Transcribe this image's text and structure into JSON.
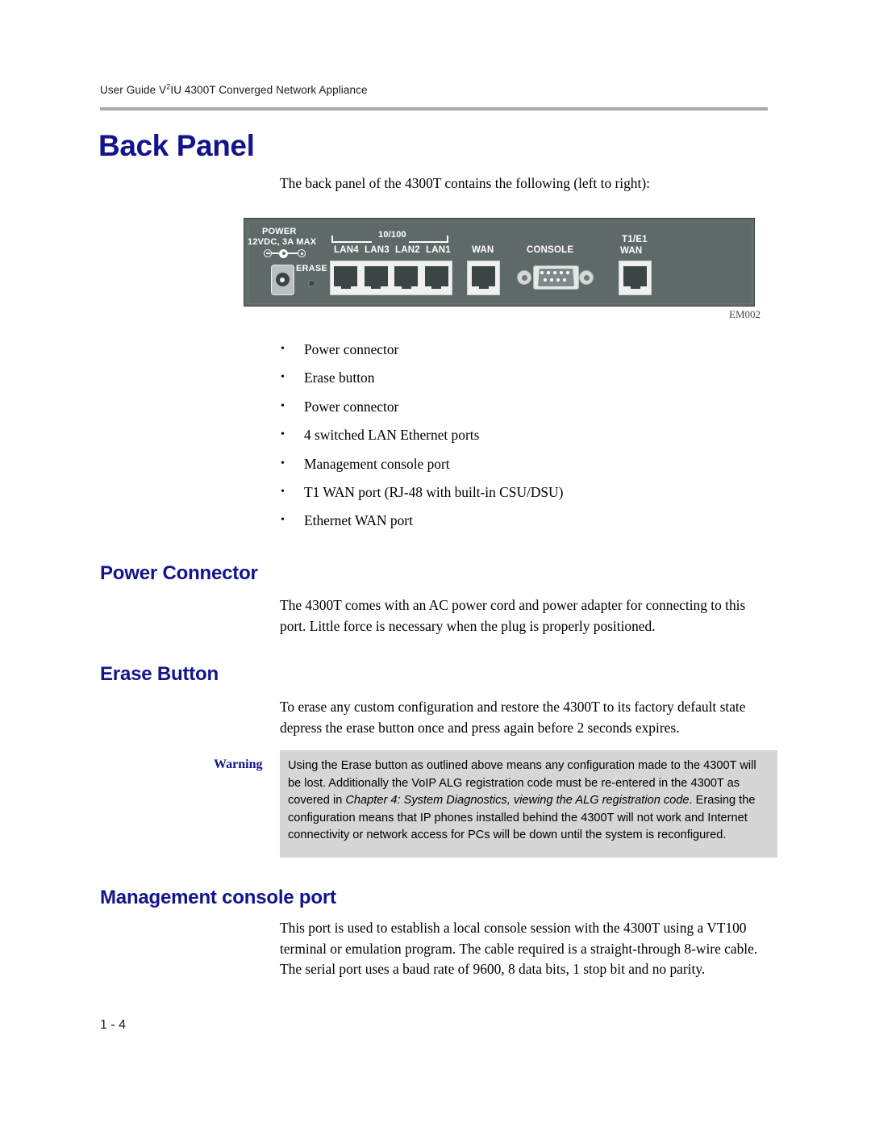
{
  "header": {
    "running_title_pre": "User Guide V",
    "running_title_sup": "2",
    "running_title_post": "IU 4300T Converged Network Appliance"
  },
  "chapter": {
    "title": "Back Panel",
    "intro": "The back panel of the 4300T contains the following (left to right):"
  },
  "figure": {
    "caption": "EM002",
    "panel": {
      "power_label": "POWER",
      "power_spec": "12VDC, 3A MAX",
      "erase_label": "ERASE",
      "speed_label": "10/100",
      "lan4": "LAN4",
      "lan3": "LAN3",
      "lan2": "LAN2",
      "lan1": "LAN1",
      "wan": "WAN",
      "console": "CONSOLE",
      "t1e1": "T1/E1",
      "t1e1_wan": "WAN"
    }
  },
  "bullets": [
    "Power connector",
    "Erase button",
    "Power connector",
    "4 switched LAN Ethernet ports",
    "Management console port",
    "T1 WAN port (RJ-48 with built-in CSU/DSU)",
    "Ethernet WAN port"
  ],
  "sections": {
    "power_connector": {
      "heading": "Power Connector",
      "body": "The 4300T comes with an AC power cord and power adapter for connecting to this port.  Little force is necessary when the plug is properly positioned."
    },
    "erase_button": {
      "heading": "Erase Button",
      "body": "To erase any custom configuration and restore the 4300T to its factory default state depress the erase button once and press again before 2 seconds expires."
    },
    "management_console": {
      "heading": "Management console port",
      "body": "This port is used to establish a local console session with the 4300T using a VT100 terminal or emulation program. The cable required is a straight-through 8-wire cable.  The serial port uses a baud rate of 9600, 8 data bits, 1 stop bit and no parity."
    }
  },
  "warning": {
    "label": "Warning",
    "text_part1": "Using the Erase button as outlined above means any configuration made to the 4300T will be lost.  Additionally the VoIP ALG registration code must be re-entered in the 4300T as covered in ",
    "text_italic": "Chapter 4:  System Diagnostics, viewing the ALG registration code",
    "text_part2": ".  Erasing the configuration means that IP phones installed behind the 4300T will not work and Internet connectivity or network access for PCs will be down until the system is reconfigured."
  },
  "footer": {
    "page_number": "1 - 4"
  },
  "colors": {
    "heading_blue": "#13138C",
    "panel_gray": "#5E6A68",
    "warning_bg": "#D6D6D6",
    "rule_gray": "#A9A9A9"
  },
  "bullet_glyph": "•"
}
